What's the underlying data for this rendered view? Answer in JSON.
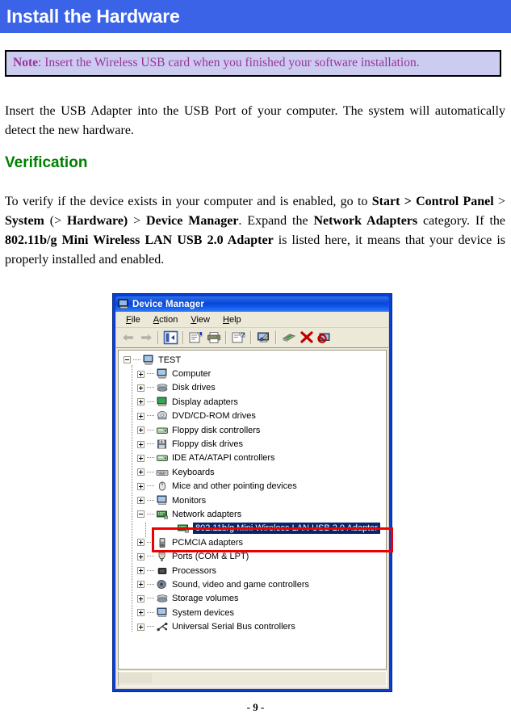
{
  "page": {
    "banner_title": "Install the Hardware",
    "banner_color": "#3b63e8",
    "footer": "- 9 -"
  },
  "note": {
    "label": "Note",
    "separator": ": ",
    "text": "Insert the Wireless USB card when you finished your software installation.",
    "background": "#ccccf0",
    "text_color": "#993399"
  },
  "intro": {
    "text": "Insert the USB Adapter into the USB Port of your computer. The system will automatically detect the new hardware."
  },
  "verification": {
    "heading": "Verification",
    "heading_color": "#008000",
    "p1": "To verify if the device exists in your computer and is enabled, go to ",
    "b1": "Start > Control Panel",
    "p2": " > ",
    "b2": "System",
    "p3": " (> ",
    "b3": "Hardware)",
    "p4": " > ",
    "b4": "Device Manager",
    "p5": ". Expand the ",
    "b5": "Network Adapters",
    "p6": " category. If the ",
    "b6": "802.11b/g Mini Wireless LAN USB 2.0 Adapter",
    "p7": " is listed here, it means that your device is properly installed and enabled."
  },
  "device_manager": {
    "title": "Device Manager",
    "menu": [
      {
        "pre": "",
        "accel": "F",
        "post": "ile"
      },
      {
        "pre": "",
        "accel": "A",
        "post": "ction"
      },
      {
        "pre": "",
        "accel": "V",
        "post": "iew"
      },
      {
        "pre": "",
        "accel": "H",
        "post": "elp"
      }
    ],
    "toolbar": [
      {
        "name": "back-icon",
        "tip": "Back"
      },
      {
        "name": "forward-icon",
        "tip": "Forward"
      },
      {
        "name": "show-console-tree-icon",
        "tip": "Show/Hide Console Tree"
      },
      {
        "name": "properties-icon",
        "tip": "Properties"
      },
      {
        "name": "print-icon",
        "tip": "Print"
      },
      {
        "name": "help-icon",
        "tip": "Help"
      },
      {
        "name": "scan-hardware-changes-icon",
        "tip": "Scan for hardware changes"
      },
      {
        "name": "update-driver-icon",
        "tip": "Update Driver"
      },
      {
        "name": "uninstall-icon",
        "tip": "Uninstall"
      },
      {
        "name": "disable-icon",
        "tip": "Disable"
      }
    ],
    "tree": [
      {
        "label": "TEST",
        "indent": 0,
        "expander": "minus",
        "icon": "computer-icon",
        "selected": false
      },
      {
        "label": "Computer",
        "indent": 1,
        "expander": "plus",
        "icon": "computer-icon",
        "selected": false
      },
      {
        "label": "Disk drives",
        "indent": 1,
        "expander": "plus",
        "icon": "disk-drive-icon",
        "selected": false
      },
      {
        "label": "Display adapters",
        "indent": 1,
        "expander": "plus",
        "icon": "display-adapter-icon",
        "selected": false
      },
      {
        "label": "DVD/CD-ROM drives",
        "indent": 1,
        "expander": "plus",
        "icon": "cdrom-icon",
        "selected": false
      },
      {
        "label": "Floppy disk controllers",
        "indent": 1,
        "expander": "plus",
        "icon": "controller-icon",
        "selected": false
      },
      {
        "label": "Floppy disk drives",
        "indent": 1,
        "expander": "plus",
        "icon": "floppy-icon",
        "selected": false
      },
      {
        "label": "IDE ATA/ATAPI controllers",
        "indent": 1,
        "expander": "plus",
        "icon": "controller-icon",
        "selected": false
      },
      {
        "label": "Keyboards",
        "indent": 1,
        "expander": "plus",
        "icon": "keyboard-icon",
        "selected": false
      },
      {
        "label": "Mice and other pointing devices",
        "indent": 1,
        "expander": "plus",
        "icon": "mouse-icon",
        "selected": false
      },
      {
        "label": "Monitors",
        "indent": 1,
        "expander": "plus",
        "icon": "monitor-icon",
        "selected": false
      },
      {
        "label": "Network adapters",
        "indent": 1,
        "expander": "minus",
        "icon": "network-adapter-icon",
        "selected": false
      },
      {
        "label": "802.11b/g Mini Wireless LAN USB 2.0 Adapter",
        "indent": 2,
        "expander": "none",
        "icon": "network-adapter-icon",
        "selected": true
      },
      {
        "label": "PCMCIA adapters",
        "indent": 1,
        "expander": "plus",
        "icon": "pcmcia-icon",
        "selected": false
      },
      {
        "label": "Ports (COM & LPT)",
        "indent": 1,
        "expander": "plus",
        "icon": "port-icon",
        "selected": false
      },
      {
        "label": "Processors",
        "indent": 1,
        "expander": "plus",
        "icon": "processor-icon",
        "selected": false
      },
      {
        "label": "Sound, video and game controllers",
        "indent": 1,
        "expander": "plus",
        "icon": "sound-icon",
        "selected": false
      },
      {
        "label": "Storage volumes",
        "indent": 1,
        "expander": "plus",
        "icon": "storage-icon",
        "selected": false
      },
      {
        "label": "System devices",
        "indent": 1,
        "expander": "plus",
        "icon": "system-device-icon",
        "selected": false
      },
      {
        "label": "Universal Serial Bus controllers",
        "indent": 1,
        "expander": "plus",
        "icon": "usb-icon",
        "selected": false
      }
    ],
    "annotation": {
      "name": "red-highlight-box",
      "color": "#ee0000"
    },
    "selection_color": "#0a246a"
  }
}
